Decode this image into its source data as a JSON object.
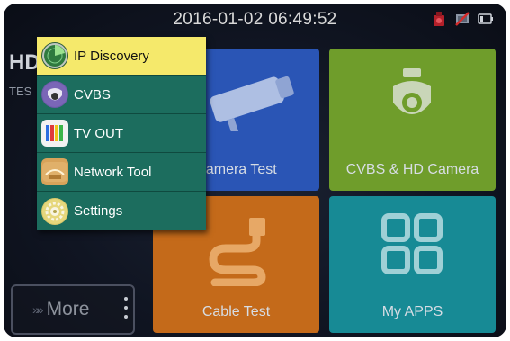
{
  "status_bar": {
    "datetime": "2016-01-02 06:49:52",
    "icons": [
      "recording-icon",
      "network-disconnected-icon",
      "battery-icon"
    ]
  },
  "background": {
    "title": "HD",
    "subtitle": "TES"
  },
  "tiles": [
    {
      "label": "Camera Test",
      "icon": "cctv-camera-icon",
      "color": "#2a55b5"
    },
    {
      "label": "CVBS & HD Camera",
      "icon": "dome-camera-icon",
      "color": "#6f9d2b"
    },
    {
      "label": "Cable Test",
      "icon": "cable-icon",
      "color": "#c46a1a"
    },
    {
      "label": "My APPS",
      "icon": "apps-grid-icon",
      "color": "#178a95"
    }
  ],
  "more_button": {
    "label": "More",
    "chevrons": "»»"
  },
  "menu": {
    "items": [
      {
        "label": "IP Discovery",
        "icon": "radar-icon",
        "active": true
      },
      {
        "label": "CVBS",
        "icon": "dome-camera-icon",
        "active": false
      },
      {
        "label": "TV OUT",
        "icon": "color-bars-icon",
        "active": false
      },
      {
        "label": "Network Tool",
        "icon": "network-tool-icon",
        "active": false
      },
      {
        "label": "Settings",
        "icon": "gear-icon",
        "active": false
      }
    ],
    "colors": {
      "background": "#1c6d5e",
      "active": "#f5e96b"
    }
  }
}
